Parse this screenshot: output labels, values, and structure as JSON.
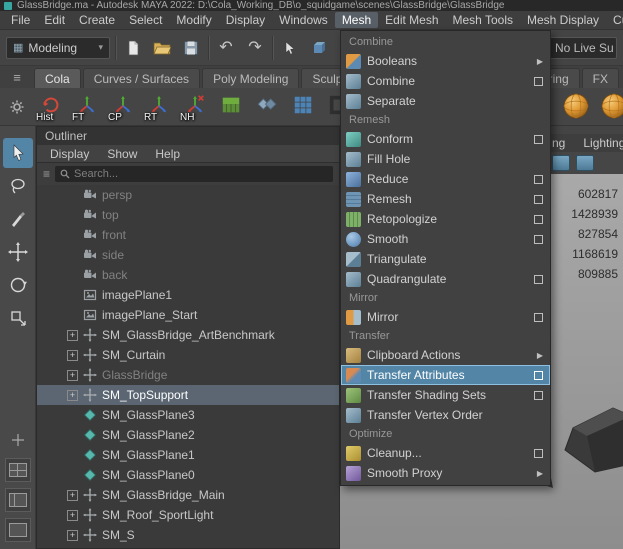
{
  "window": {
    "title": "GlassBridge.ma - Autodesk MAYA 2022: D:\\Cola_Working_DB\\o_squidgame\\scenes\\GlassBridge\\GlassBridge"
  },
  "menubar": {
    "items": [
      "File",
      "Edit",
      "Create",
      "Select",
      "Modify",
      "Display",
      "Windows",
      "Mesh",
      "Edit Mesh",
      "Mesh Tools",
      "Mesh Display",
      "Cur"
    ],
    "active": "Mesh"
  },
  "toolbar": {
    "menu_set": "Modeling",
    "live_surface": "No Live Su"
  },
  "shelf": {
    "active_tab": "Cola",
    "tabs": [
      "Cola",
      "Curves / Surfaces",
      "Poly Modeling",
      "Sculp"
    ],
    "tabs_right": [
      "ering",
      "FX"
    ],
    "buttons": [
      {
        "label": "Hist",
        "icon": "history"
      },
      {
        "label": "FT",
        "icon": "axis-tripod"
      },
      {
        "label": "CP",
        "icon": "axis-tripod"
      },
      {
        "label": "RT",
        "icon": "axis-tripod"
      },
      {
        "label": "NH",
        "icon": "axis-tripod-x"
      },
      {
        "label": "",
        "icon": "grass-block"
      },
      {
        "label": "",
        "icon": "diamonds"
      },
      {
        "label": "",
        "icon": "grid"
      },
      {
        "label": "",
        "icon": "dark-tool"
      }
    ],
    "buttons_right": [
      {
        "label": "",
        "icon": "sphere"
      },
      {
        "label": "",
        "icon": "sphere"
      },
      {
        "label": "",
        "icon": "sphere"
      }
    ]
  },
  "outliner": {
    "title": "Outliner",
    "menus": [
      "Display",
      "Show",
      "Help"
    ],
    "search_placeholder": "Search...",
    "items": [
      {
        "label": "persp",
        "icon": "camera",
        "grayed": true
      },
      {
        "label": "top",
        "icon": "camera",
        "grayed": true
      },
      {
        "label": "front",
        "icon": "camera",
        "grayed": true
      },
      {
        "label": "side",
        "icon": "camera",
        "grayed": true
      },
      {
        "label": "back",
        "icon": "camera",
        "grayed": true
      },
      {
        "label": "imagePlane1",
        "icon": "image-plane"
      },
      {
        "label": "imagePlane_Start",
        "icon": "image-plane"
      },
      {
        "label": "SM_GlassBridge_ArtBenchmark",
        "icon": "transform",
        "expand": true
      },
      {
        "label": "SM_Curtain",
        "icon": "transform",
        "expand": true
      },
      {
        "label": "GlassBridge",
        "icon": "transform",
        "expand": true,
        "grayed": true
      },
      {
        "label": "SM_TopSupport",
        "icon": "transform",
        "expand": true,
        "selected": true
      },
      {
        "label": "SM_GlassPlane3",
        "icon": "mesh"
      },
      {
        "label": "SM_GlassPlane2",
        "icon": "mesh"
      },
      {
        "label": "SM_GlassPlane1",
        "icon": "mesh"
      },
      {
        "label": "SM_GlassPlane0",
        "icon": "mesh"
      },
      {
        "label": "SM_GlassBridge_Main",
        "icon": "transform",
        "expand": true
      },
      {
        "label": "SM_Roof_SportLight",
        "icon": "transform",
        "expand": true
      },
      {
        "label": "SM_S",
        "icon": "transform",
        "expand": true
      }
    ]
  },
  "mesh_menu": {
    "items": [
      {
        "type": "header",
        "label": "Combine"
      },
      {
        "label": "Booleans",
        "icon": "booleans",
        "submenu": true
      },
      {
        "label": "Combine",
        "icon": "combine",
        "option": true
      },
      {
        "label": "Separate",
        "icon": "separate"
      },
      {
        "type": "header",
        "label": "Remesh"
      },
      {
        "label": "Conform",
        "icon": "conform",
        "option": true
      },
      {
        "label": "Fill Hole",
        "icon": "fill-hole"
      },
      {
        "label": "Reduce",
        "icon": "reduce",
        "option": true
      },
      {
        "label": "Remesh",
        "icon": "remesh",
        "option": true
      },
      {
        "label": "Retopologize",
        "icon": "retopologize",
        "option": true
      },
      {
        "label": "Smooth",
        "icon": "smooth",
        "option": true
      },
      {
        "label": "Triangulate",
        "icon": "triangulate"
      },
      {
        "label": "Quadrangulate",
        "icon": "quadrangulate",
        "option": true
      },
      {
        "type": "header",
        "label": "Mirror"
      },
      {
        "label": "Mirror",
        "icon": "mirror",
        "option": true
      },
      {
        "type": "header",
        "label": "Transfer"
      },
      {
        "label": "Clipboard Actions",
        "icon": "clipboard-actions",
        "submenu": true
      },
      {
        "label": "Transfer Attributes",
        "icon": "transfer-attributes",
        "option": true,
        "highlight": true
      },
      {
        "label": "Transfer Shading Sets",
        "icon": "transfer-shading-sets",
        "option": true
      },
      {
        "label": "Transfer Vertex Order",
        "icon": "transfer-vertex-order"
      },
      {
        "type": "header",
        "label": "Optimize"
      },
      {
        "label": "Cleanup...",
        "icon": "cleanup",
        "option": true
      },
      {
        "label": "Smooth Proxy",
        "icon": "smooth-proxy",
        "submenu": true
      }
    ]
  },
  "viewport": {
    "panel_menus": [
      "ng",
      "Lighting"
    ],
    "poly_counts": [
      "602817",
      "1428939",
      "827854",
      "1168619",
      "809885"
    ]
  },
  "colors": {
    "accent_blue": "#5285a6",
    "viewport_gray": "#9c9c9c",
    "ui_dark": "#444444"
  }
}
